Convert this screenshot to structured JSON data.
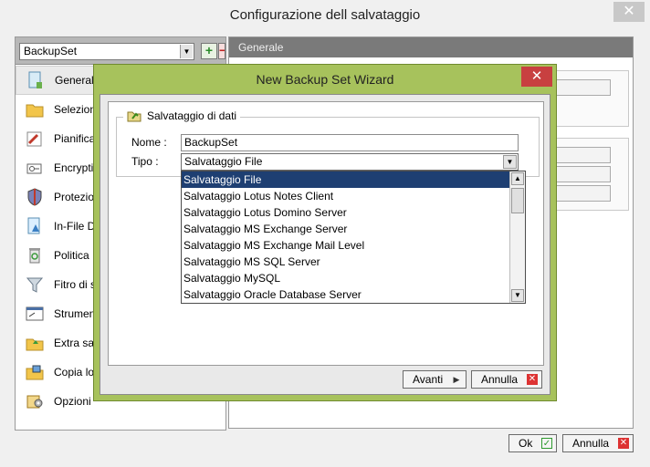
{
  "window": {
    "title": "Configurazione dell salvataggio",
    "close_glyph": "✕"
  },
  "backupset": {
    "selected": "BackupSet",
    "plus": "+",
    "minus": "−"
  },
  "sidebar": {
    "items": [
      {
        "label": "Generale",
        "icon": "document-icon"
      },
      {
        "label": "Selezioni",
        "icon": "folder-icon"
      },
      {
        "label": "Pianificazione",
        "icon": "calendar-icon"
      },
      {
        "label": "Encryption",
        "icon": "key-icon"
      },
      {
        "label": "Protezione",
        "icon": "shield-icon"
      },
      {
        "label": "In-File Delta",
        "icon": "file-delta-icon"
      },
      {
        "label": "Politica",
        "icon": "recycle-icon"
      },
      {
        "label": "Fitro di selezione",
        "icon": "filter-icon"
      },
      {
        "label": "Strumenti",
        "icon": "dir-icon"
      },
      {
        "label": "Extra salvataggio",
        "icon": "extra-folder-icon"
      },
      {
        "label": "Copia locale",
        "icon": "copy-folder-icon"
      },
      {
        "label": "Opzioni",
        "icon": "gear-icon"
      }
    ]
  },
  "main": {
    "header": "Generale"
  },
  "footer": {
    "ok_label": "Ok",
    "cancel_label": "Annulla"
  },
  "wizard": {
    "title": "New Backup Set Wizard",
    "close_glyph": "✕",
    "section_title": "Salvataggio di dati",
    "name_label": "Nome :",
    "name_value": "BackupSet",
    "type_label": "Tipo :",
    "type_value": "Salvataggio File",
    "type_options": [
      "Salvataggio File",
      "Salvataggio Lotus Notes Client",
      "Salvataggio Lotus Domino Server",
      "Salvataggio MS Exchange Server",
      "Salvataggio MS Exchange Mail Level",
      "Salvataggio MS SQL Server",
      "Salvataggio MySQL",
      "Salvataggio Oracle Database Server"
    ],
    "next_label": "Avanti",
    "cancel_label": "Annulla"
  },
  "colors": {
    "wizard_frame": "#a7c25c",
    "selection": "#1e3f72",
    "close_red": "#c84040"
  }
}
